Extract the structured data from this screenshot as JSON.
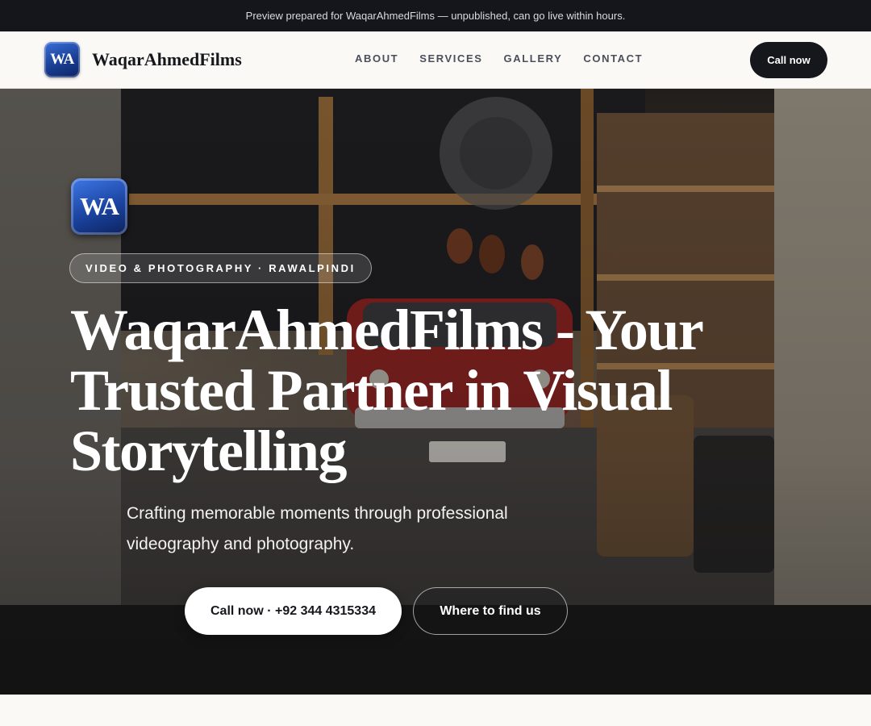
{
  "announcement": "Preview prepared for WaqarAhmedFilms — unpublished, can go live within hours.",
  "nav": {
    "logo_text": "WA",
    "brand": "WaqarAhmedFilms",
    "links": [
      "ABOUT",
      "SERVICES",
      "GALLERY",
      "CONTACT"
    ],
    "cta": "Call now"
  },
  "hero": {
    "logo_text": "WA",
    "badge": "VIDEO & PHOTOGRAPHY · RAWALPINDI",
    "title": "WaqarAhmedFilms - Your Trusted Partner in Visual Storytelling",
    "subtitle": "Crafting memorable moments through professional videography and photography.",
    "primary_button": "Call now · +92 344 4315334",
    "secondary_button": "Where to find us"
  },
  "colors": {
    "dark": "#15171c",
    "accent_blue": "#1a3f95",
    "page_bg": "#faf9f6"
  }
}
